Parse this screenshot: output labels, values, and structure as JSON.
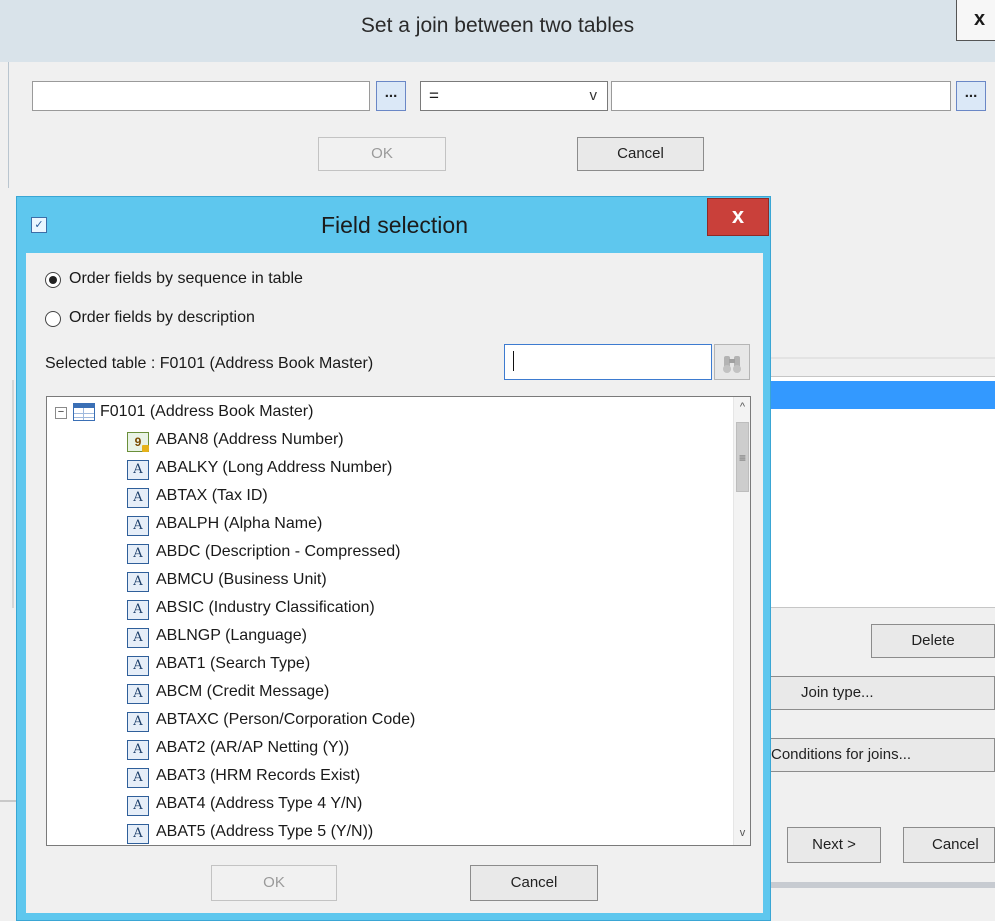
{
  "join_dialog": {
    "title": "Set a join between two tables",
    "close_glyph": "x",
    "browse_glyph": "...",
    "operator": "=",
    "ok_label": "OK",
    "cancel_label": "Cancel"
  },
  "wizard": {
    "delete_label": "Delete",
    "join_type_label": "Join type...",
    "conditions_label": "Conditions for joins...",
    "next_label": "Next >",
    "cancel_label": "Cancel"
  },
  "field_selection": {
    "title": "Field selection",
    "close_glyph": "x",
    "order_by_sequence_label": "Order fields by sequence in table",
    "order_by_description_label": "Order fields by description",
    "selected_table_label": "Selected table :  F0101 (Address Book Master)",
    "search_value": "",
    "tree_root": "F0101 (Address Book Master)",
    "fields": [
      {
        "label": "ABAN8 (Address Number)",
        "icon": "key-field-icon"
      },
      {
        "label": "ABALKY (Long Address Number)",
        "icon": "alpha-field-icon"
      },
      {
        "label": "ABTAX (Tax ID)",
        "icon": "alpha-field-icon"
      },
      {
        "label": "ABALPH (Alpha Name)",
        "icon": "alpha-field-icon"
      },
      {
        "label": "ABDC (Description - Compressed)",
        "icon": "alpha-field-icon"
      },
      {
        "label": "ABMCU (Business Unit)",
        "icon": "alpha-field-icon"
      },
      {
        "label": "ABSIC (Industry Classification)",
        "icon": "alpha-field-icon"
      },
      {
        "label": "ABLNGP (Language)",
        "icon": "alpha-field-icon"
      },
      {
        "label": "ABAT1 (Search Type)",
        "icon": "alpha-field-icon"
      },
      {
        "label": "ABCM (Credit Message)",
        "icon": "alpha-field-icon"
      },
      {
        "label": "ABTAXC (Person/Corporation Code)",
        "icon": "alpha-field-icon"
      },
      {
        "label": "ABAT2 (AR/AP Netting (Y))",
        "icon": "alpha-field-icon"
      },
      {
        "label": "ABAT3 (HRM Records Exist)",
        "icon": "alpha-field-icon"
      },
      {
        "label": "ABAT4 (Address Type 4 Y/N)",
        "icon": "alpha-field-icon"
      },
      {
        "label": "ABAT5 (Address Type 5 (Y/N))",
        "icon": "alpha-field-icon"
      }
    ],
    "ok_label": "OK",
    "cancel_label": "Cancel"
  },
  "icons": {
    "key_glyph": "9",
    "alpha_glyph": "A",
    "expander_glyph": "−",
    "scroll_up_glyph": "^",
    "scroll_down_glyph": "v",
    "chevron_glyph": "v"
  }
}
